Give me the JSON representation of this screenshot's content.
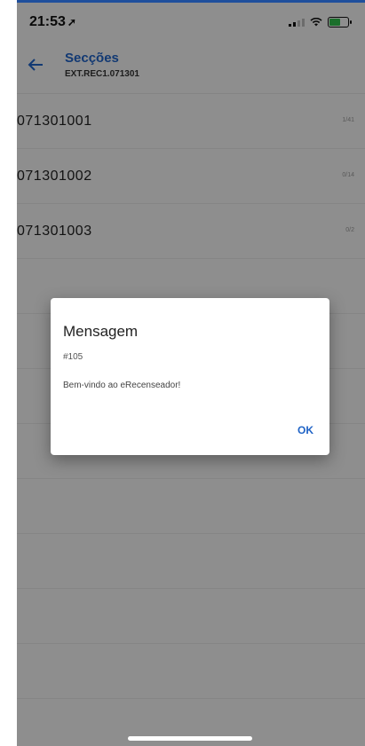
{
  "status_bar": {
    "time": "21:53",
    "location_glyph": "➚",
    "icons": [
      "signal-icon",
      "wifi-icon",
      "battery-charging-icon"
    ]
  },
  "app_bar": {
    "back_icon": "arrow-left-icon",
    "title": "Secções",
    "subtitle": "EXT.REC1.071301"
  },
  "sections": [
    {
      "code": "071301001",
      "count": "1/41"
    },
    {
      "code": "071301002",
      "count": "0/14"
    },
    {
      "code": "071301003",
      "count": "0/2"
    }
  ],
  "dialog": {
    "title": "Mensagem",
    "code": "#105",
    "message": "Bem-vindo ao eRecenseador!",
    "ok_label": "OK"
  },
  "colors": {
    "accent": "#1f63c6",
    "overlay": "rgba(0,0,0,0.42)",
    "background": "#f4f4f4"
  }
}
